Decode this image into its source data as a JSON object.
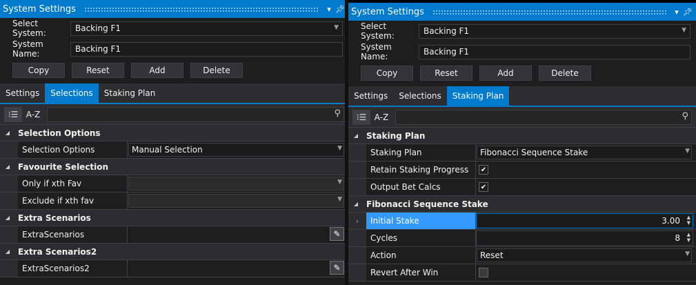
{
  "left": {
    "title": "System Settings",
    "select_system_label": "Select System:",
    "select_system_value": "Backing F1",
    "system_name_label": "System Name:",
    "system_name_value": "Backing F1",
    "buttons": [
      "Copy",
      "Reset",
      "Add",
      "Delete"
    ],
    "tabs": [
      "Settings",
      "Selections",
      "Staking Plan"
    ],
    "active_tab": "Selections",
    "az_label": "A-Z",
    "categories": [
      {
        "title": "Selection Options",
        "rows": [
          {
            "name": "Selection Options",
            "value": "Manual Selection"
          }
        ]
      },
      {
        "title": "Favourite Selection",
        "rows": [
          {
            "name": "Only if xth Fav",
            "value": ""
          },
          {
            "name": "Exclude if xth fav",
            "value": ""
          }
        ]
      },
      {
        "title": "Extra Scenarios",
        "rows": [
          {
            "name": "ExtraScenarios",
            "value": ""
          }
        ]
      },
      {
        "title": "Extra Scenarios2",
        "rows": [
          {
            "name": "ExtraScenarios2",
            "value": ""
          }
        ]
      }
    ]
  },
  "right": {
    "title": "System Settings",
    "select_system_label": "Select System:",
    "select_system_value": "Backing F1",
    "system_name_label": "System Name:",
    "system_name_value": "Backing F1",
    "buttons": [
      "Copy",
      "Reset",
      "Add",
      "Delete"
    ],
    "tabs": [
      "Settings",
      "Selections",
      "Staking Plan"
    ],
    "active_tab": "Staking Plan",
    "az_label": "A-Z",
    "categories": [
      {
        "title": "Staking Plan",
        "rows": [
          {
            "name": "Staking Plan",
            "value": "Fibonacci Sequence Stake"
          },
          {
            "name": "Retain Staking Progress",
            "checked": true
          },
          {
            "name": "Output Bet Calcs",
            "checked": true
          }
        ]
      },
      {
        "title": "Fibonacci Sequence Stake",
        "rows": [
          {
            "name": "Initial Stake",
            "value": "3.00"
          },
          {
            "name": "Cycles",
            "value": "8"
          },
          {
            "name": "Action",
            "value": "Reset"
          },
          {
            "name": "Revert After Win",
            "checked": false
          }
        ]
      }
    ]
  },
  "colors": {
    "accent": "#007acc",
    "selection": "#3399ff",
    "background": "#1e1e1e"
  }
}
